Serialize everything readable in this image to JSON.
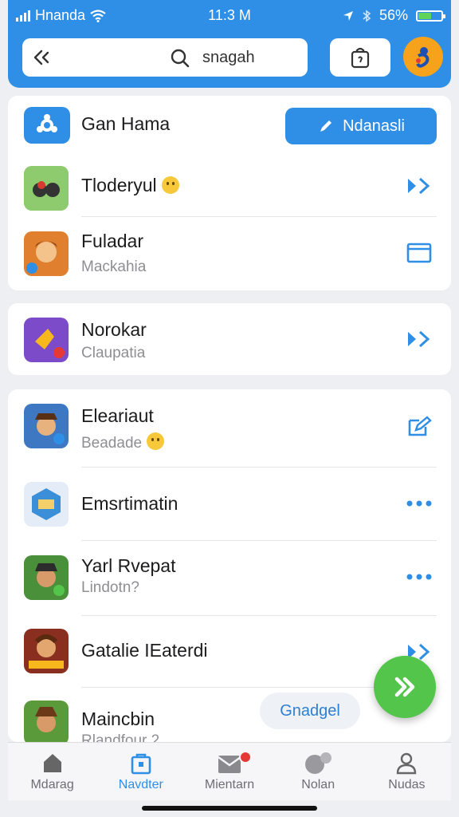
{
  "status": {
    "carrier": "Hnanda",
    "time": "11:3 M",
    "battery": "56%",
    "battery_level": 0.56
  },
  "search": {
    "text": "snagah"
  },
  "icons": {
    "back": "back-icon",
    "search": "search-icon",
    "bag": "bag-icon",
    "avatar": "avatar",
    "arrow": "double-arrow-icon",
    "folder": "folder-icon",
    "edit": "edit-icon",
    "more": "more-icon"
  },
  "section1": {
    "header_title": "Gan Hama",
    "button_label": "Ndanasli",
    "rows": [
      {
        "title": "Tloderyul",
        "subtitle": ""
      },
      {
        "title": "Fuladar",
        "subtitle": "Mackahia"
      }
    ]
  },
  "section2": {
    "rows": [
      {
        "title": "Norokar",
        "subtitle": "Claupatia"
      }
    ]
  },
  "section3": {
    "rows": [
      {
        "title": "Eleariaut",
        "subtitle": "Beadade"
      },
      {
        "title": "Emsrtimatin",
        "subtitle": ""
      },
      {
        "title": "Yarl Rvepat",
        "subtitle": "Lindotn?"
      },
      {
        "title": "Gatalie IEaterdi",
        "subtitle": ""
      },
      {
        "title": "Maincbin",
        "subtitle": "Rlandfour 2"
      }
    ]
  },
  "chip_label": "Gnadgel",
  "tabs": [
    {
      "label": "Mdarag",
      "icon": "home-icon"
    },
    {
      "label": "Navdter",
      "icon": "bag-icon",
      "active": true
    },
    {
      "label": "Mientarn",
      "icon": "inbox-icon",
      "badge": true
    },
    {
      "label": "Nolan",
      "icon": "chat-icon"
    },
    {
      "label": "Nudas",
      "icon": "person-icon"
    }
  ],
  "colors": {
    "primary": "#2f8fe6",
    "fab": "#52c54a",
    "accent": "#f6a21a",
    "badge": "#e53935"
  }
}
